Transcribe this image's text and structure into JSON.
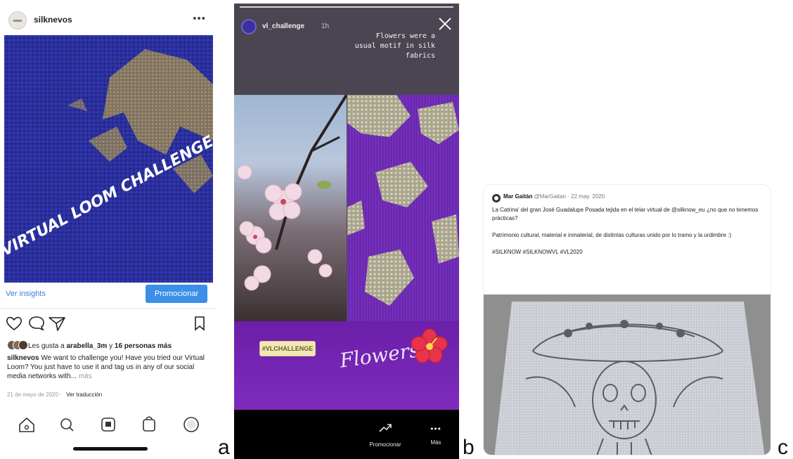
{
  "panel_labels": {
    "a": "a",
    "b": "b",
    "c": "c"
  },
  "instagram_post": {
    "username": "silknevos",
    "more_icon": "more-horizontal-icon",
    "image_text": "VIRTUAL LOOM CHALLENGE",
    "insights_label": "Ver insights",
    "promote_label": "Promocionar",
    "likes_prefix": "Les gusta a",
    "likes_user": "arabella_3m",
    "likes_mid": "y",
    "likes_count": "16 personas más",
    "caption_user": "silknevos",
    "caption_text": "We want to challenge you! Have you tried our Virtual Loom? You just have to use it and tag us in any of our social media networks with...",
    "caption_more": "más",
    "date": "21 de mayo de 2020",
    "translate_label": "Ver traducción",
    "nav_icons": [
      "home-icon",
      "search-icon",
      "reels-icon",
      "shop-icon",
      "profile-icon"
    ]
  },
  "instagram_story": {
    "username": "vl_challenge",
    "time": "1h",
    "story_text": "Flowers were a\nusual motif in silk\nfabrics",
    "hashtag": "#VLCHALLENGE",
    "flowers_label": "Flowers",
    "promote_label": "Promocionar",
    "more_label": "Más",
    "colors": {
      "band": "#6c1fa8",
      "fabric": "#6d2bb2"
    }
  },
  "tweet": {
    "author": "Mar Gaitán",
    "handle": "@MarGaitan",
    "date": "22 may. 2020",
    "paragraph1": "La Catrina' del gran José Guadalupe Posada tejida en el telar virtual de @silknow_eu ¿no que no tenemos prácticas?",
    "paragraph2": "Patrimonio cultural, material e inmaterial, de distintas culturas unido por lo tramo y la urdimbre :)",
    "hashtags": "#SILKNOW #SILKNOWVL #VL2020"
  }
}
